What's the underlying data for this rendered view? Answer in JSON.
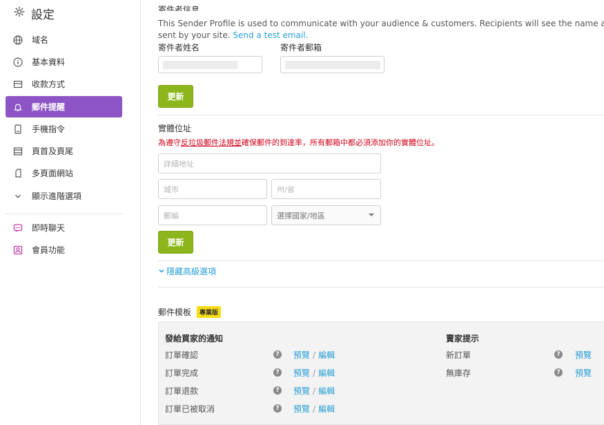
{
  "sidebar": {
    "title": "設定",
    "items": [
      {
        "label": "域名",
        "icon": "globe-icon"
      },
      {
        "label": "基本資料",
        "icon": "info-icon"
      },
      {
        "label": "收款方式",
        "icon": "payment-card-icon"
      },
      {
        "label": "郵件提醒",
        "icon": "bell-icon",
        "active": true
      },
      {
        "label": "手機指令",
        "icon": "mobile-icon"
      },
      {
        "label": "頁首及頁尾",
        "icon": "layout-icon"
      },
      {
        "label": "多頁面網站",
        "icon": "pages-icon"
      },
      {
        "label": "顯示進階選項",
        "icon": "chevron-down-icon"
      }
    ],
    "extras": [
      {
        "label": "即時聊天",
        "icon": "chat-icon"
      },
      {
        "label": "會員功能",
        "icon": "member-icon"
      }
    ]
  },
  "sender": {
    "section_title": "寄件者信息",
    "desc_line1": "This Sender Profile is used to communicate with your audience & customers. Recipients will see the name and email in",
    "desc_line2": "sent by your site.",
    "test_link": "Send a test email.",
    "name_label": "寄件者姓名",
    "email_label": "寄件者郵箱",
    "update_label": "更新"
  },
  "address": {
    "title": "實體位址",
    "warn_prefix": "為遵守",
    "warn_link": "反垃圾郵件法規",
    "warn_mid": "並",
    "warn_suffix": "確保郵件的到達率，所有郵箱中都必須添加你的實體位址。",
    "detail_placeholder": "詳細地址",
    "city_placeholder": "城市",
    "state_placeholder": "州/省",
    "zip_placeholder": "郵編",
    "country_select": "選擇國家/地區",
    "update_label": "更新",
    "advanced_toggle": "隱藏高級選項"
  },
  "templates": {
    "title": "郵件模板",
    "badge": "專業版",
    "buyer_heading": "發給買家的通知",
    "seller_heading": "賣家提示",
    "buyer_rows": [
      "訂單確認",
      "訂單完成",
      "訂單退款",
      "訂單已被取消"
    ],
    "seller_rows": [
      "新訂單",
      "無庫存"
    ],
    "preview": "預覽",
    "edit": "編輯",
    "sep": "/",
    "help": "?"
  },
  "colors": {
    "accent_purple": "#8d54c6",
    "button_green": "#8cb61b",
    "link_blue": "#2b9fd6",
    "warning_red": "#d0021b",
    "badge_yellow": "#f8dd12"
  }
}
